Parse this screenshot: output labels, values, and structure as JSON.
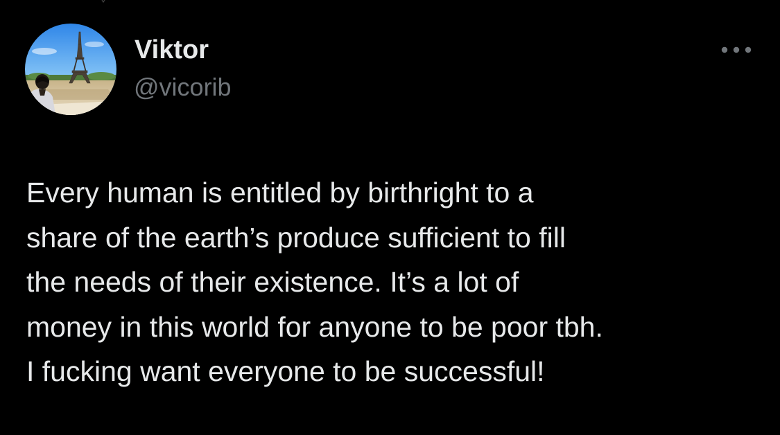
{
  "author": {
    "display_name": "Viktor",
    "handle": "@vicorib",
    "avatar": "profile-photo-eiffel-tower"
  },
  "menu": {
    "icon": "more-horizontal-icon"
  },
  "tweet": {
    "text": "Every human is entitled by birthright to a\nshare of the earth’s produce sufficient to fill\nthe needs of their existence. It’s a lot of\nmoney in this world for anyone to be poor tbh.\nI fucking want everyone to be successful!"
  },
  "colors": {
    "background": "#000000",
    "primary_text": "#e7e9ea",
    "secondary_text": "#71767b"
  }
}
